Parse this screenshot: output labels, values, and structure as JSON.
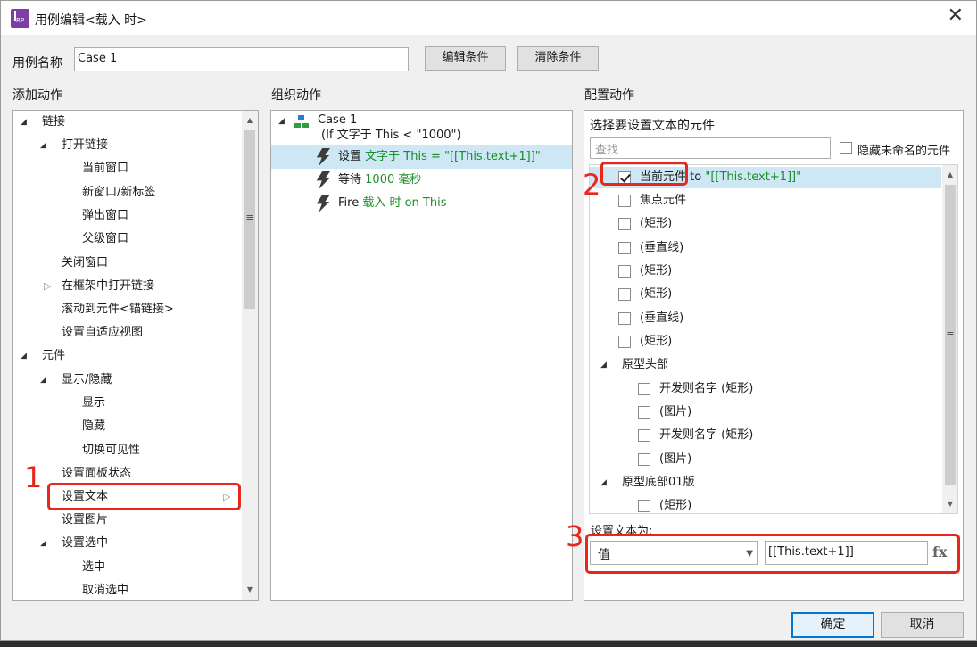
{
  "window": {
    "title": "用例编辑<载入 时>",
    "app_icon_text": "RP",
    "close_glyph": "✕"
  },
  "case_name": {
    "label": "用例名称",
    "value": "Case 1",
    "edit_conditions": "编辑条件",
    "clear_conditions": "清除条件"
  },
  "add_actions": {
    "header": "添加动作",
    "items": [
      "链接",
      "打开链接",
      "当前窗口",
      "新窗口/新标签",
      "弹出窗口",
      "父级窗口",
      "关闭窗口",
      "在框架中打开链接",
      "滚动到元件<锚链接>",
      "设置自适应视图",
      "元件",
      "显示/隐藏",
      "显示",
      "隐藏",
      "切换可见性",
      "设置面板状态",
      "设置文本",
      "设置图片",
      "设置选中",
      "选中",
      "取消选中"
    ]
  },
  "organize_actions": {
    "header": "组织动作",
    "case_title": "Case 1",
    "case_condition": "(If 文字于 This < \"1000\")",
    "actions": [
      {
        "verb": "设置",
        "detail": "文字于 This = \"[[This.text+1]]\""
      },
      {
        "verb": "等待",
        "detail": "1000 毫秒"
      },
      {
        "verb": "Fire",
        "detail": "载入 时 on This"
      }
    ]
  },
  "configure_actions": {
    "header": "配置动作",
    "subheader": "选择要设置文本的元件",
    "search_placeholder": "查找",
    "hide_unnamed_label": "隐藏未命名的元件",
    "widgets": [
      {
        "label": "当前元件",
        "suffix_to": " to ",
        "suffix_value": "\"[[This.text+1]]\"",
        "checked": true
      },
      {
        "label": "焦点元件",
        "checked": false
      },
      {
        "label": "(矩形)",
        "checked": false
      },
      {
        "label": "(垂直线)",
        "checked": false
      },
      {
        "label": "(矩形)",
        "checked": false
      },
      {
        "label": "(矩形)",
        "checked": false
      },
      {
        "label": "(垂直线)",
        "checked": false
      },
      {
        "label": "(矩形)",
        "checked": false
      }
    ],
    "group1": {
      "title": "原型头部",
      "items": [
        "开发则名字 (矩形)",
        "(图片)",
        "开发则名字 (矩形)",
        "(图片)"
      ]
    },
    "group2": {
      "title": "原型底部01版",
      "items": [
        "(矩形)"
      ]
    },
    "set_text_label": "设置文本为:",
    "value_type": "值",
    "value_text": "[[This.text+1]]",
    "fx_label": "fx"
  },
  "annotations": [
    "1",
    "2",
    "3"
  ],
  "footer": {
    "ok": "确定",
    "cancel": "取消"
  },
  "colors": {
    "highlight_red": "#e8261c",
    "selection_blue": "#cde8f4",
    "action_green": "#1b8c2a",
    "primary_border": "#0078d7"
  }
}
